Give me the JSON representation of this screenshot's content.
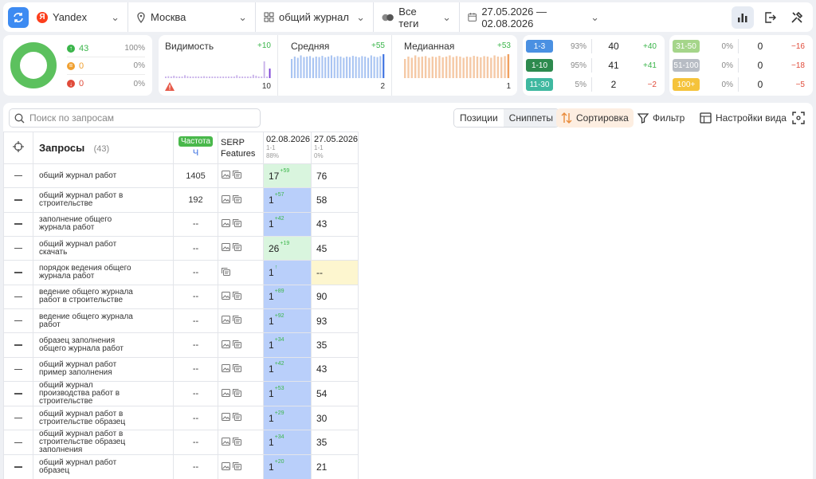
{
  "topbar": {
    "engine": "Yandex",
    "region": "Москва",
    "group": "общий журнал ра",
    "tags": "Все теги",
    "date_range": "27.05.2026 — 02.08.2026"
  },
  "summary": {
    "up": {
      "value": "43",
      "pct": "100%"
    },
    "same": {
      "value": "0",
      "pct": "0%"
    },
    "down": {
      "value": "0",
      "pct": "0%"
    }
  },
  "metrics": [
    {
      "title": "Видимость",
      "delta": "+10",
      "value": "10",
      "color": "#c9b2ea",
      "accent": "#7a3fd6",
      "levels": [
        0.05,
        0.08,
        0.06,
        0.1,
        0.07,
        0.05,
        0.06,
        0.12,
        0.08,
        0.05,
        0.06,
        0.07,
        0.05,
        0.06,
        0.08,
        0.05,
        0.06,
        0.05,
        0.05,
        0.06,
        0.05,
        0.05,
        0.06,
        0.05,
        0.05,
        0.06,
        0.12,
        0.06,
        0.05,
        0.06,
        0.05,
        0.05,
        0.14,
        0.1,
        0.05,
        0.06,
        0.7,
        0.05,
        0.4
      ],
      "warn": true
    },
    {
      "title": "Средняя",
      "delta": "+55",
      "value": "2",
      "color": "#a9c4f2",
      "accent": "#3a6fe0",
      "levels": [
        0.8,
        0.9,
        0.85,
        0.95,
        0.88,
        0.9,
        0.92,
        0.85,
        0.9,
        0.88,
        0.93,
        0.87,
        0.9,
        0.95,
        0.88,
        0.92,
        0.9,
        0.85,
        0.9,
        0.88,
        0.93,
        0.9,
        0.87,
        0.92,
        0.9,
        0.85,
        0.95,
        0.9,
        0.88,
        0.92,
        1.0
      ]
    },
    {
      "title": "Медианная",
      "delta": "+53",
      "value": "1",
      "color": "#f5c9a6",
      "accent": "#f0a060",
      "levels": [
        0.8,
        0.9,
        0.85,
        0.95,
        0.88,
        0.9,
        0.92,
        0.85,
        0.9,
        0.88,
        0.93,
        0.87,
        0.9,
        0.95,
        0.88,
        0.92,
        0.9,
        0.85,
        0.9,
        0.88,
        0.93,
        0.9,
        0.87,
        0.92,
        0.9,
        0.85,
        0.95,
        0.9,
        0.88,
        0.92,
        1.0
      ]
    }
  ],
  "ranges": [
    {
      "label": "1-3",
      "color": "#4a90e2",
      "pct": "93%",
      "value": "40",
      "delta": "+40",
      "dcolor": "#3ab54a"
    },
    {
      "label": "1-10",
      "color": "#2d8a4e",
      "pct": "95%",
      "value": "41",
      "delta": "+41",
      "dcolor": "#3ab54a"
    },
    {
      "label": "11-30",
      "color": "#3fb8a0",
      "pct": "5%",
      "value": "2",
      "delta": "−2",
      "dcolor": "#e04b3a"
    }
  ],
  "ranges2": [
    {
      "label": "31-50",
      "color": "#a5d58a",
      "pct": "0%",
      "value": "0",
      "delta": "−16",
      "dcolor": "#e04b3a"
    },
    {
      "label": "51-100",
      "color": "#b7bcc4",
      "pct": "0%",
      "value": "0",
      "delta": "−18",
      "dcolor": "#e04b3a"
    },
    {
      "label": "100+",
      "color": "#f5c33b",
      "pct": "0%",
      "value": "0",
      "delta": "−5",
      "dcolor": "#e04b3a"
    }
  ],
  "toolbar": {
    "search_placeholder": "Поиск по запросам",
    "tab_positions": "Позиции",
    "tab_snippets": "Сниппеты",
    "sort": "Сортировка",
    "filter": "Фильтр",
    "view_settings": "Настройки вида"
  },
  "table": {
    "col_queries": "Запросы",
    "count": "(43)",
    "col_freq": "Частота",
    "freq_sub": "Ч",
    "col_serp": "SERP Features",
    "date1": "02.08.2026",
    "date1_sub1": "1-1",
    "date1_sub2": "88%",
    "date2": "27.05.2026",
    "date2_sub1": "1-1",
    "date2_sub2": "0%",
    "rows": [
      {
        "q": "общий журнал работ",
        "freq": "1405",
        "pos": "17",
        "delta": "+59",
        "prev": "76",
        "cls": "g",
        "ico": 2
      },
      {
        "q": "общий журнал работ в строительстве",
        "freq": "192",
        "pos": "1",
        "delta": "+57",
        "prev": "58",
        "cls": "b",
        "ico": 2
      },
      {
        "q": "заполнение общего журнала работ",
        "freq": "--",
        "pos": "1",
        "delta": "+42",
        "prev": "43",
        "cls": "b",
        "ico": 2
      },
      {
        "q": "общий журнал работ скачать",
        "freq": "--",
        "pos": "26",
        "delta": "+19",
        "prev": "45",
        "cls": "g",
        "ico": 2
      },
      {
        "q": "порядок ведения общего журнала работ",
        "freq": "--",
        "pos": "1",
        "delta": "↑",
        "prev": "--",
        "cls": "b",
        "ico": 1,
        "prevcls": "y"
      },
      {
        "q": "ведение общего журнала работ в строительстве",
        "freq": "--",
        "pos": "1",
        "delta": "+89",
        "prev": "90",
        "cls": "b",
        "ico": 2
      },
      {
        "q": "ведение общего журнала работ",
        "freq": "--",
        "pos": "1",
        "delta": "+92",
        "prev": "93",
        "cls": "b",
        "ico": 2
      },
      {
        "q": "образец заполнения общего журнала работ",
        "freq": "--",
        "pos": "1",
        "delta": "+34",
        "prev": "35",
        "cls": "b",
        "ico": 2
      },
      {
        "q": "общий журнал работ пример заполнения",
        "freq": "--",
        "pos": "1",
        "delta": "+42",
        "prev": "43",
        "cls": "b",
        "ico": 2
      },
      {
        "q": "общий журнал производства работ в строительстве",
        "freq": "--",
        "pos": "1",
        "delta": "+53",
        "prev": "54",
        "cls": "b",
        "ico": 2
      },
      {
        "q": "общий журнал работ в строительстве образец",
        "freq": "--",
        "pos": "1",
        "delta": "+29",
        "prev": "30",
        "cls": "b",
        "ico": 2
      },
      {
        "q": "общий журнал работ в строительстве образец заполнения",
        "freq": "--",
        "pos": "1",
        "delta": "+34",
        "prev": "35",
        "cls": "b",
        "ico": 2
      },
      {
        "q": "общий журнал работ образец",
        "freq": "--",
        "pos": "1",
        "delta": "+20",
        "prev": "21",
        "cls": "b",
        "ico": 2
      }
    ]
  }
}
